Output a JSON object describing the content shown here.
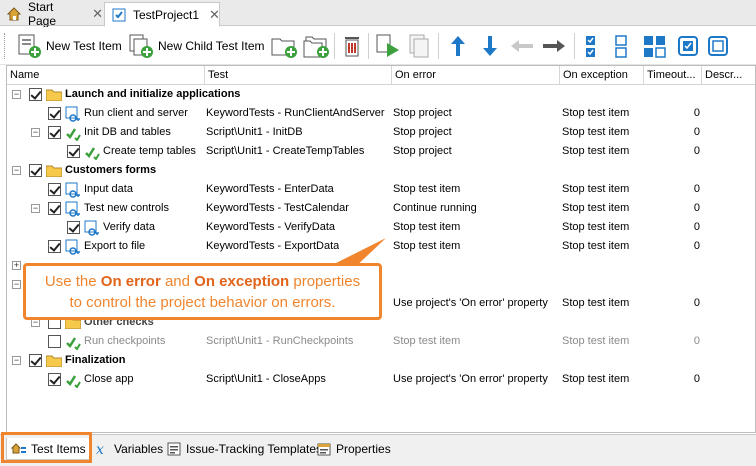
{
  "tabs": [
    {
      "label": "Start Page",
      "close": "✕"
    },
    {
      "label": "TestProject1",
      "close": "✕"
    }
  ],
  "toolbar": {
    "new_test_item": "New Test Item",
    "new_child_test_item": "New Child Test Item"
  },
  "columns": [
    "Name",
    "Test",
    "On error",
    "On exception",
    "Timeout...",
    "Descr..."
  ],
  "rows": [
    {
      "name": "Launch and initialize applications",
      "test": "",
      "on_error": "",
      "on_exception": "",
      "timeout": ""
    },
    {
      "name": "Run client and server",
      "test": "KeywordTests - RunClientAndServer",
      "on_error": "Stop project",
      "on_exception": "Stop test item",
      "timeout": "0"
    },
    {
      "name": "Init DB and tables",
      "test": "Script\\Unit1 - InitDB",
      "on_error": "Stop project",
      "on_exception": "Stop test item",
      "timeout": "0"
    },
    {
      "name": "Create temp tables",
      "test": "Script\\Unit1 - CreateTempTables",
      "on_error": "Stop project",
      "on_exception": "Stop test item",
      "timeout": "0"
    },
    {
      "name": "Customers forms",
      "test": "",
      "on_error": "",
      "on_exception": "",
      "timeout": ""
    },
    {
      "name": "Input data",
      "test": "KeywordTests - EnterData",
      "on_error": "Stop test item",
      "on_exception": "Stop test item",
      "timeout": "0"
    },
    {
      "name": "Test new controls",
      "test": "KeywordTests - TestCalendar",
      "on_error": "Continue running",
      "on_exception": "Stop test item",
      "timeout": "0"
    },
    {
      "name": "Verify data",
      "test": "KeywordTests - VerifyData",
      "on_error": "Stop test item",
      "on_exception": "Stop test item",
      "timeout": "0"
    },
    {
      "name": "Export to file",
      "test": "KeywordTests - ExportData",
      "on_error": "Stop test item",
      "on_exception": "Stop test item",
      "timeout": "0"
    },
    {
      "name": "",
      "test": "",
      "on_error": "",
      "on_exception": "",
      "timeout": ""
    },
    {
      "name": "",
      "test": "",
      "on_error": "",
      "on_exception": "",
      "timeout": ""
    },
    {
      "name": "",
      "test": "",
      "on_error": "Use project's 'On error' property",
      "on_exception": "Stop test item",
      "timeout": "0"
    },
    {
      "name": "Other checks",
      "test": "",
      "on_error": "",
      "on_exception": "",
      "timeout": ""
    },
    {
      "name": "Run checkpoints",
      "test": "Script\\Unit1 - RunCheckpoints",
      "on_error": "Stop test item",
      "on_exception": "Stop test item",
      "timeout": "0"
    },
    {
      "name": "Finalization",
      "test": "",
      "on_error": "",
      "on_exception": "",
      "timeout": ""
    },
    {
      "name": "Close app",
      "test": "Script\\Unit1 - CloseApps",
      "on_error": "Use project's 'On error' property",
      "on_exception": "Stop test item",
      "timeout": "0"
    }
  ],
  "callout": {
    "pre": "Use the ",
    "b1": "On error",
    "mid": " and ",
    "b2": "On exception",
    "post1": " properties",
    "line2": "to control the project behavior on errors."
  },
  "bottom_tabs": [
    "Test Items",
    "Variables",
    "Issue-Tracking Templates",
    "Properties"
  ],
  "colors": {
    "accent": "#f0852e",
    "blue_icon": "#1e78c8",
    "green": "#3ca03c"
  }
}
